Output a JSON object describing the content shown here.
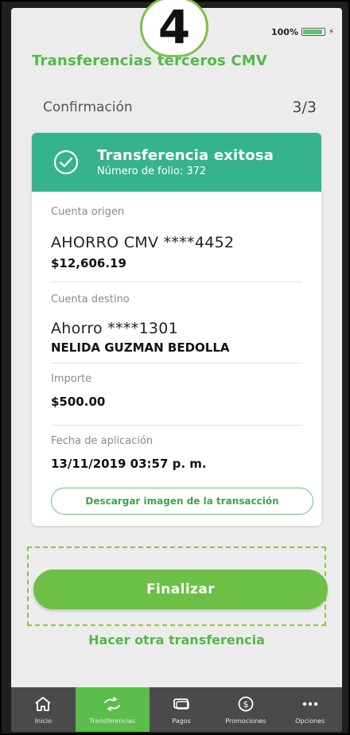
{
  "step_badge": "4",
  "status": {
    "battery": "100%"
  },
  "app_title": "Transferencias terceros CMV",
  "step": {
    "label": "Confirmación",
    "count": "3/3"
  },
  "result": {
    "title": "Transferencia exitosa",
    "folio": "Número de folio: 372"
  },
  "origin": {
    "label": "Cuenta origen",
    "account": "AHORRO CMV ****4452",
    "balance": "$12,606.19"
  },
  "destination": {
    "label": "Cuenta destino",
    "account": "Ahorro ****1301",
    "holder": "NELIDA GUZMAN BEDOLLA"
  },
  "amount": {
    "label": "Importe",
    "value": "$500.00"
  },
  "date": {
    "label": "Fecha de aplicación",
    "value": "13/11/2019 03:57 p. m."
  },
  "download_label": "Descargar imagen de la transacción",
  "finalize_label": "Finalizar",
  "another_label": "Hacer otra transferencia",
  "colors": {
    "brand_green": "#54b848",
    "teal": "#35b38e",
    "tabbar": "#4a4a4a"
  },
  "tabs": [
    {
      "label": "Inicio",
      "icon": "home-icon"
    },
    {
      "label": "Transferencias",
      "icon": "transfer-icon",
      "active": true
    },
    {
      "label": "Pagos",
      "icon": "payments-icon"
    },
    {
      "label": "Promociones",
      "icon": "promotions-icon"
    },
    {
      "label": "Opciones",
      "icon": "more-icon"
    }
  ]
}
